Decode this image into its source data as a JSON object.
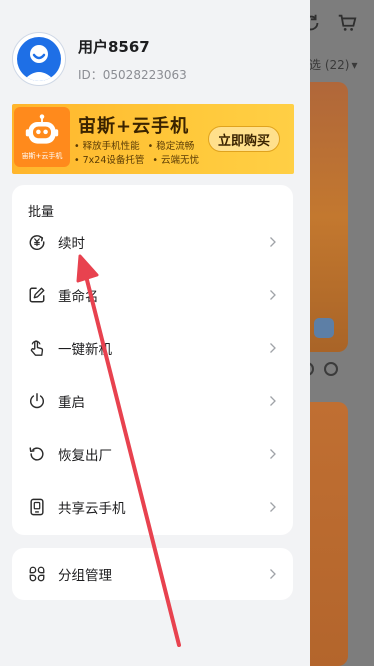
{
  "background": {
    "filter_label": "选 (22)"
  },
  "profile": {
    "username": "用户8567",
    "id_text": "ID：05028223063"
  },
  "banner": {
    "logo_text": "宙斯+云手机",
    "title": "宙斯+云手机",
    "points": [
      [
        "• 释放手机性能",
        "• 稳定流畅"
      ],
      [
        "• 7x24设备托管",
        "• 云端无忧"
      ]
    ],
    "cta_label": "立即购买"
  },
  "batch_menu": {
    "section_title": "批量",
    "items": [
      {
        "icon": "renew-yuan-icon",
        "label": "续时"
      },
      {
        "icon": "rename-icon",
        "label": "重命名"
      },
      {
        "icon": "one-click-new-device-icon",
        "label": "一键新机"
      },
      {
        "icon": "power-icon",
        "label": "重启"
      },
      {
        "icon": "factory-reset-icon",
        "label": "恢复出厂"
      },
      {
        "icon": "share-phone-icon",
        "label": "共享云手机"
      }
    ]
  },
  "group_menu": {
    "label": "分组管理",
    "icon": "grid-group-icon"
  },
  "colors": {
    "accent_blue": "#1e6fe6",
    "banner_orange": "#ffb52c",
    "arrow_red": "#e8424f"
  }
}
